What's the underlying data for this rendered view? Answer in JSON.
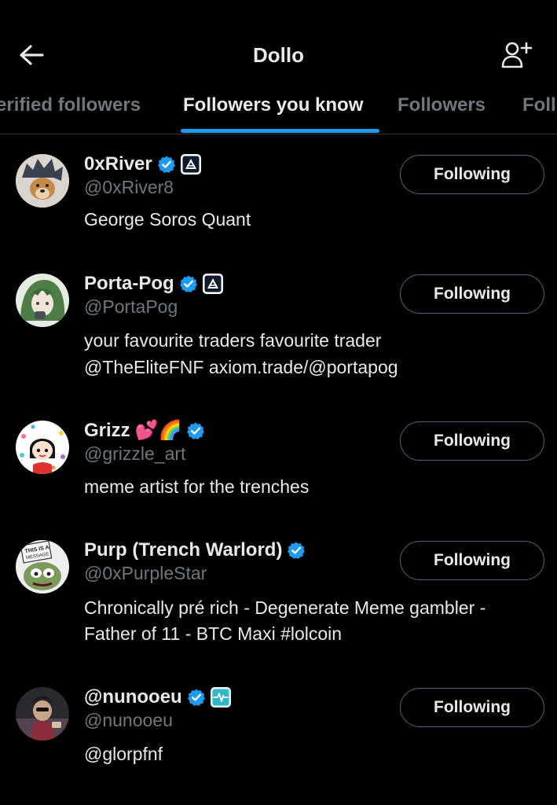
{
  "header": {
    "title": "Dollo"
  },
  "tabs": [
    {
      "label": "erified followers"
    },
    {
      "label": "Followers you know"
    },
    {
      "label": "Followers"
    },
    {
      "label": "Foll"
    }
  ],
  "users": [
    {
      "name": "0xRiver",
      "handle": "@0xRiver8",
      "bio": [
        "George Soros Quant"
      ],
      "button": "Following"
    },
    {
      "name": "Porta-Pog",
      "handle": "@PortaPog",
      "bio": [
        "your favourite traders favourite trader",
        "@TheEliteFNF axiom.trade/@portapog"
      ],
      "button": "Following"
    },
    {
      "name": "Grizz",
      "name_emojis": "💕🌈",
      "handle": "@grizzle_art",
      "bio": [
        "meme artist for the trenches"
      ],
      "button": "Following"
    },
    {
      "name": "Purp (Trench Warlord)",
      "handle": "@0xPurpleStar",
      "bio": [
        "Chronically pré rich - Degenerate Meme gambler -",
        "Father of 11 - BTC Maxi #lolcoin"
      ],
      "button": "Following"
    },
    {
      "name": "@nunooeu",
      "handle": "@nunooeu",
      "bio": [
        "@glorpfnf"
      ],
      "button": "Following"
    }
  ],
  "avatar_labels": {
    "purp_sign": "THIS IS A MESSAGE"
  },
  "colors": {
    "background": "#000000",
    "accent": "#1d9bf0",
    "secondary_text": "#71767b",
    "primary_text": "#e7e9ea",
    "border": "#2f3336"
  }
}
